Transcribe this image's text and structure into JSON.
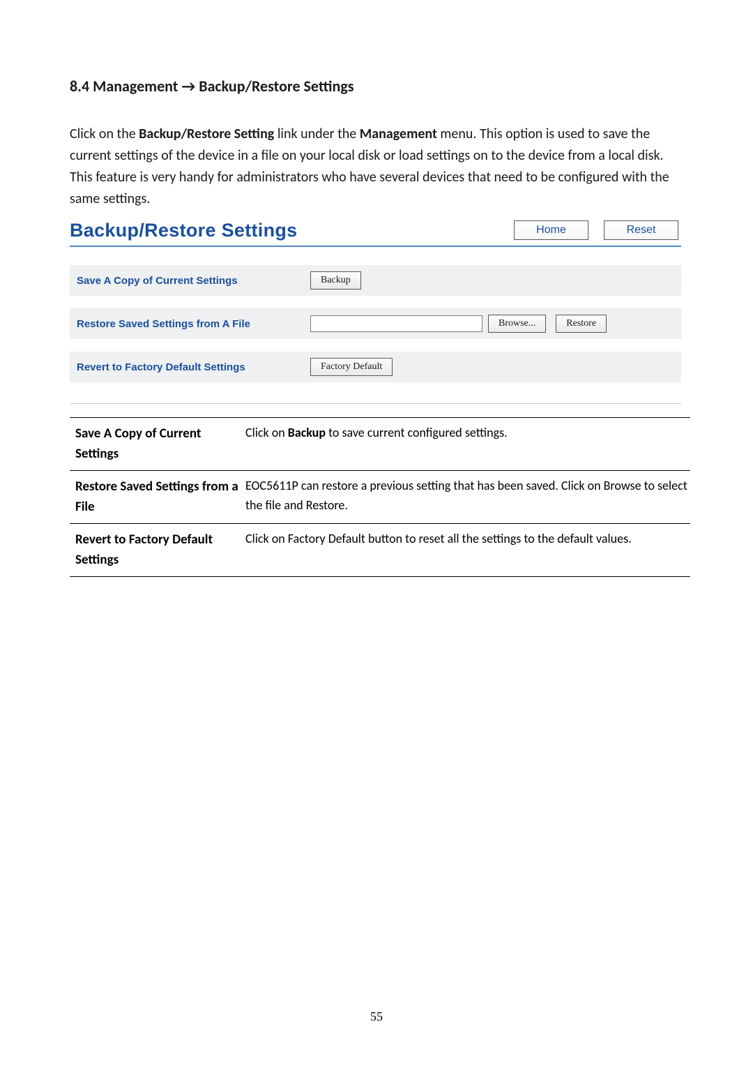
{
  "heading": "8.4 Management → Backup/Restore Settings",
  "intro": {
    "pre1": "Click on the ",
    "b1": "Backup/Restore Setting",
    "mid1": " link under the ",
    "b2": "Management",
    "post1": " menu. This option is used to save the current settings of the device in a file on your local disk or load settings on to the device from a local disk. This feature is very handy for administrators who have several devices that need to be configured with the same settings."
  },
  "panel": {
    "title": "Backup/Restore Settings",
    "nav_home": "Home",
    "nav_reset": "Reset",
    "row1_label": "Save A Copy of Current Settings",
    "row1_btn": "Backup",
    "row2_label": "Restore Saved Settings from A File",
    "row2_browse": "Browse...",
    "row2_restore": "Restore",
    "row3_label": "Revert to Factory Default Settings",
    "row3_btn": "Factory Default"
  },
  "desc": {
    "r1_term": "Save A Copy of Current Settings",
    "r1_def_pre": "Click on ",
    "r1_def_b": "Backup",
    "r1_def_post": " to save current configured settings.",
    "r2_term": "Restore Saved Settings from a File",
    "r2_def": "EOC5611P can restore a previous setting that has been saved. Click on Browse to select the file and Restore.",
    "r3_term": "Revert to Factory Default Settings",
    "r3_def": "Click on Factory Default button to reset all the settings to the default values."
  },
  "page_number": "55"
}
